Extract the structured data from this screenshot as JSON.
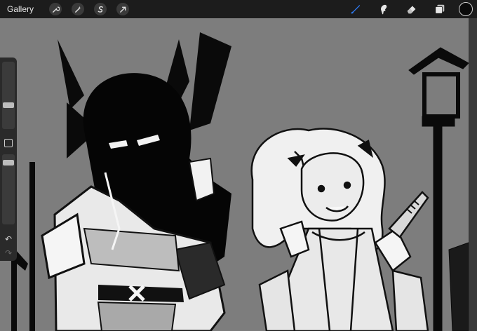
{
  "topbar": {
    "gallery_label": "Gallery",
    "left_tools": [
      {
        "name": "actions",
        "icon": "wrench-icon"
      },
      {
        "name": "adjustments",
        "icon": "magic-wand-icon"
      },
      {
        "name": "selection",
        "icon": "selection-s-icon"
      },
      {
        "name": "transform",
        "icon": "arrow-cursor-icon"
      }
    ],
    "right_tools": [
      {
        "name": "brush",
        "icon": "brush-icon",
        "active": true
      },
      {
        "name": "smudge",
        "icon": "smudge-icon"
      },
      {
        "name": "eraser",
        "icon": "eraser-icon"
      },
      {
        "name": "layers",
        "icon": "layers-icon"
      }
    ],
    "current_color": "#0a0a0a",
    "active_tool_color": "#2f7bf5"
  },
  "sidebar": {
    "size_slider_level": 0.3,
    "opacity_slider_level": 0.25,
    "modify_icon": "square-icon",
    "undo_icon": "undo-icon",
    "redo_icon": "redo-icon"
  }
}
